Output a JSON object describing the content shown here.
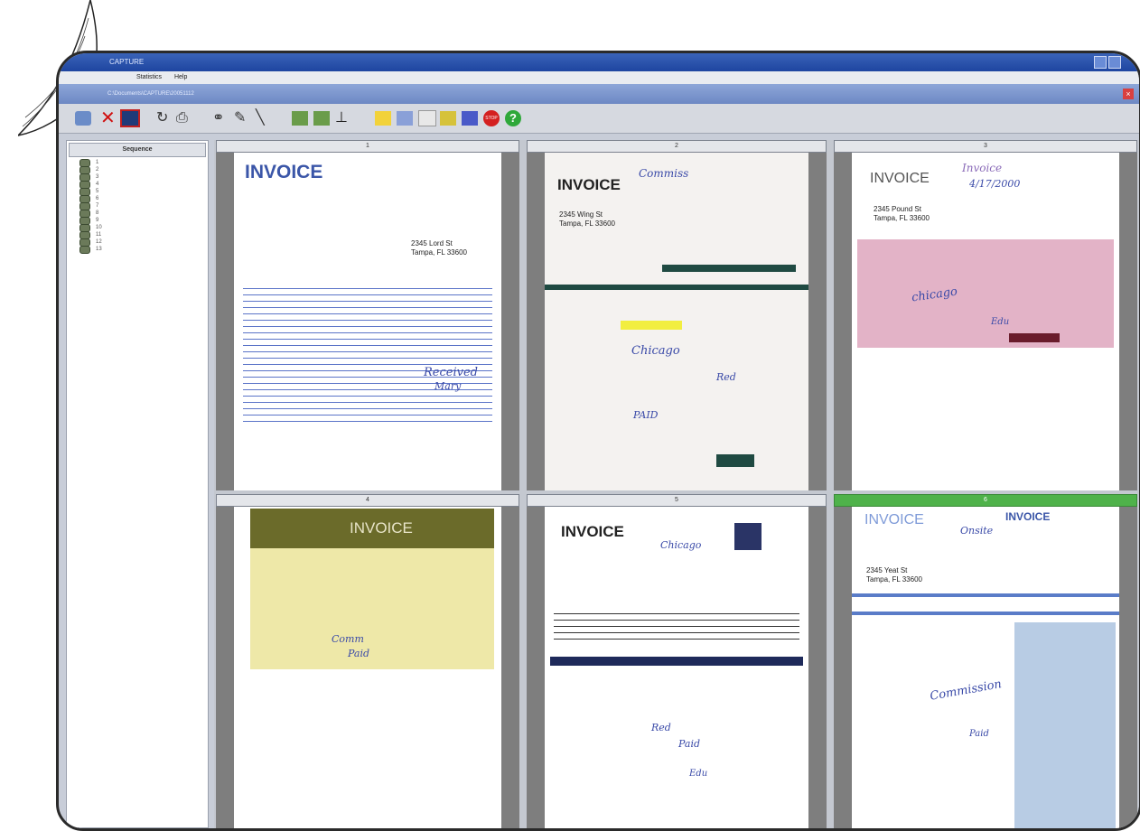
{
  "window": {
    "title": "CAPTURE",
    "doc_path": "C:\\Documents\\CAPTURE\\20051112",
    "controls": [
      "minimize-icon",
      "close-icon"
    ]
  },
  "menu": {
    "items": [
      "Statistics",
      "Help"
    ]
  },
  "toolbar": {
    "buttons": [
      "scan-icon",
      "delete-icon",
      "flag-icon",
      "rotate-icon",
      "print-icon",
      "link-icon",
      "brush-icon",
      "line-icon",
      "document-icon",
      "document-stack-icon",
      "split-icon",
      "renumber-icon",
      "filter-icon",
      "list-icon",
      "index-icon",
      "grid-icon",
      "stop-icon",
      "help-icon"
    ],
    "stop_label": "STOP",
    "help_label": "?"
  },
  "sequence": {
    "header": "Sequence",
    "items": [
      "1",
      "2",
      "3",
      "4",
      "5",
      "6",
      "7",
      "8",
      "9",
      "10",
      "11",
      "12",
      "13"
    ]
  },
  "thumbnails": [
    {
      "label": "1",
      "title": "INVOICE",
      "address": "2345 Lord St\nTampa, FL 33600",
      "handwriting": [
        "Received",
        "Mary"
      ],
      "style": "blue",
      "active": false
    },
    {
      "label": "2",
      "title": "INVOICE",
      "address": "2345 Wing St\nTampa, FL 33600",
      "handwriting": [
        "Commiss",
        "Chicago",
        "Red",
        "PAID"
      ],
      "style": "gray",
      "active": false
    },
    {
      "label": "3",
      "title": "INVOICE",
      "address": "2345 Pound St\nTampa, FL 33600",
      "handwriting": [
        "Invoice",
        "4/17/2000",
        "chicago",
        "Edu"
      ],
      "style": "pink",
      "active": false
    },
    {
      "label": "4",
      "title": "INVOICE",
      "address": "",
      "handwriting": [
        "Comm",
        "Paid"
      ],
      "style": "yellow",
      "active": false
    },
    {
      "label": "5",
      "title": "INVOICE",
      "address": "",
      "handwriting": [
        "Chicago",
        "Red",
        "Paid",
        "Edu"
      ],
      "style": "white",
      "active": false
    },
    {
      "label": "6",
      "title": "INVOICE",
      "subtitle": "INVOICE",
      "address": "2345 Yeat St\nTampa, FL 33600",
      "handwriting": [
        "Onsite",
        "Commission",
        "Paid"
      ],
      "style": "lightblue",
      "active": true
    }
  ]
}
